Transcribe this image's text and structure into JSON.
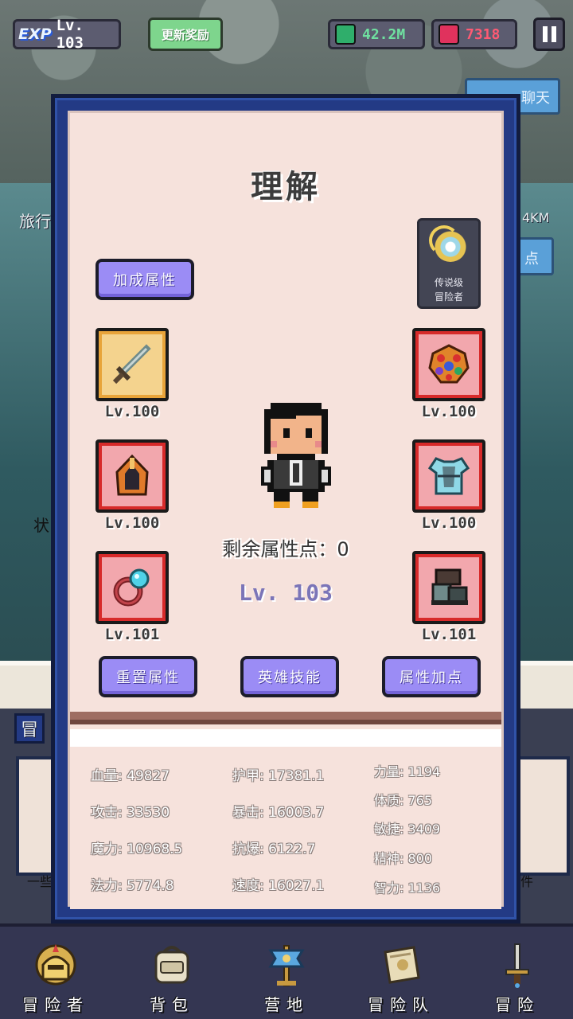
{
  "topbar": {
    "exp_badge": "EXP",
    "level": "Lv. 103",
    "reward_button": "更新奖励",
    "gems_green": "42.2M",
    "gems_red": "7318"
  },
  "background": {
    "chat_button": "聊天",
    "left_text": "旅行",
    "distance_fragment": "4KM",
    "side_button_fragment": "点",
    "status_fragment": "状",
    "bottom_left_fragment": "冒",
    "panel_left_fragment": "一些",
    "panel_right_fragment": "件"
  },
  "dialog": {
    "title": "理解",
    "bonus_button": "加成属性",
    "legend_line1": "传说级",
    "legend_line2": "冒险者",
    "slots": {
      "weapon": "Lv.100",
      "helmet": "Lv.100",
      "ring": "Lv.101",
      "amulet": "Lv.100",
      "armor": "Lv.100",
      "boots": "Lv.101"
    },
    "remaining_points": "剩余属性点：0",
    "hero_level": "Lv. 103",
    "reset_button": "重置属性",
    "skill_button": "英雄技能",
    "add_points_button": "属性加点"
  },
  "stats": {
    "hp": "血量: 49827",
    "attack": "攻击: 33530",
    "magic_power": "魔力: 10968.5",
    "mana": "法力: 5774.8",
    "armor": "护甲: 17381.1",
    "crit": "暴击: 16003.7",
    "crit_resist": "抗爆: 6122.7",
    "speed": "速度: 16027.1",
    "strength": "力量: 1194",
    "constitution": "体质: 765",
    "agility": "敏捷: 3409",
    "spirit": "精神: 800",
    "intelligence": "智力: 1136"
  },
  "nav": {
    "adventurer": "冒险者",
    "backpack": "背包",
    "camp": "营地",
    "team": "冒险队",
    "adventure": "冒险"
  },
  "icons": [
    "sword-icon",
    "helmet-icon",
    "ring-icon",
    "amulet-icon",
    "chest-armor-icon",
    "boots-icon",
    "legend-emblem-icon",
    "green-gem-icon",
    "red-gem-icon",
    "pause-icon"
  ]
}
